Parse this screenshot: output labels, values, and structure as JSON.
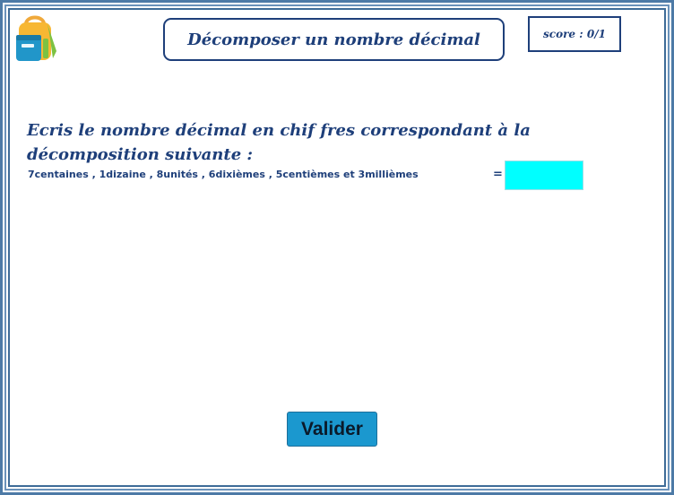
{
  "header": {
    "title": "Décomposer un nombre décimal",
    "score": "score : 0/1",
    "logo_icon": "backpack-icon"
  },
  "exercise": {
    "instruction": "Ecris le nombre décimal en chif fres correspondant à la décomposition suivante :",
    "decomposition": "7centaines ,  1dizaine ,  8unités ,  6dixièmes ,  5centièmes et 3millièmes",
    "equals": "=",
    "answer_value": ""
  },
  "actions": {
    "validate_label": "Valider"
  },
  "colors": {
    "text": "#1e3f7a",
    "border": "#3d6a95",
    "answer_bg": "#00ffff",
    "button_bg": "#1b98cf"
  }
}
